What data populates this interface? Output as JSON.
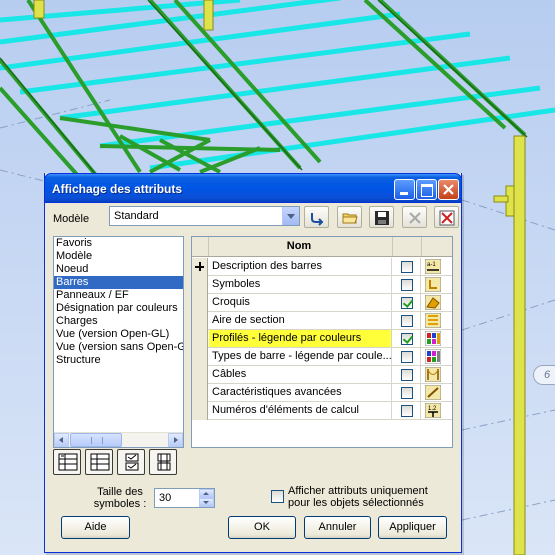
{
  "background": {
    "grid_label": "6",
    "colors": {
      "sky": "#c9d9f4",
      "beam_cyan": "#19e6e6",
      "beam_green": "#2a9d2a",
      "column_yellow": "#dfe34a"
    }
  },
  "dialog": {
    "title": "Affichage des attributs",
    "modele_label": "Modèle",
    "modele_value": "Standard",
    "toolbar": [
      {
        "name": "load-icon"
      },
      {
        "name": "folder-icon"
      },
      {
        "name": "save-icon"
      },
      {
        "name": "delete-icon"
      },
      {
        "name": "filter-icon"
      }
    ],
    "categories": [
      {
        "label": "Favoris",
        "selected": false
      },
      {
        "label": "Modèle",
        "selected": false
      },
      {
        "label": "Noeud",
        "selected": false
      },
      {
        "label": "Barres",
        "selected": true
      },
      {
        "label": "Panneaux / EF",
        "selected": false
      },
      {
        "label": "Désignation par couleurs",
        "selected": false
      },
      {
        "label": "Charges",
        "selected": false
      },
      {
        "label": "Vue (version Open-GL)",
        "selected": false
      },
      {
        "label": "Vue (version sans Open-GL)",
        "selected": false
      },
      {
        "label": "Structure",
        "selected": false
      }
    ],
    "grid": {
      "header_nom": "Nom",
      "rows": [
        {
          "name": "Description des barres",
          "checked": false,
          "expand": true,
          "highlight": false,
          "icon": "bar-description-icon"
        },
        {
          "name": "Symboles",
          "checked": false,
          "expand": false,
          "highlight": false,
          "icon": "symbols-icon"
        },
        {
          "name": "Croquis",
          "checked": true,
          "expand": false,
          "highlight": false,
          "icon": "sketch-icon"
        },
        {
          "name": "Aire de section",
          "checked": false,
          "expand": false,
          "highlight": false,
          "icon": "section-area-icon"
        },
        {
          "name": "Profilés - légende par couleurs",
          "checked": true,
          "expand": false,
          "highlight": true,
          "icon": "profiles-legend-icon"
        },
        {
          "name": "Types de barre - légende par coule...",
          "checked": false,
          "expand": false,
          "highlight": false,
          "icon": "bar-types-legend-icon"
        },
        {
          "name": "Câbles",
          "checked": false,
          "expand": false,
          "highlight": false,
          "icon": "cables-icon"
        },
        {
          "name": "Caractéristiques avancées",
          "checked": false,
          "expand": false,
          "highlight": false,
          "icon": "advanced-icon"
        },
        {
          "name": "Numéros d'éléments de calcul",
          "checked": false,
          "expand": false,
          "highlight": false,
          "icon": "element-numbers-icon"
        }
      ]
    },
    "taille_label_1": "Taille des",
    "taille_label_2": "symboles :",
    "taille_value": "30",
    "afficher_label_1": "Afficher attributs uniquement",
    "afficher_label_2": "pour les objets sélectionnés",
    "afficher_checked": false,
    "buttons": {
      "aide": "Aide",
      "ok": "OK",
      "annuler": "Annuler",
      "appliquer": "Appliquer"
    }
  }
}
